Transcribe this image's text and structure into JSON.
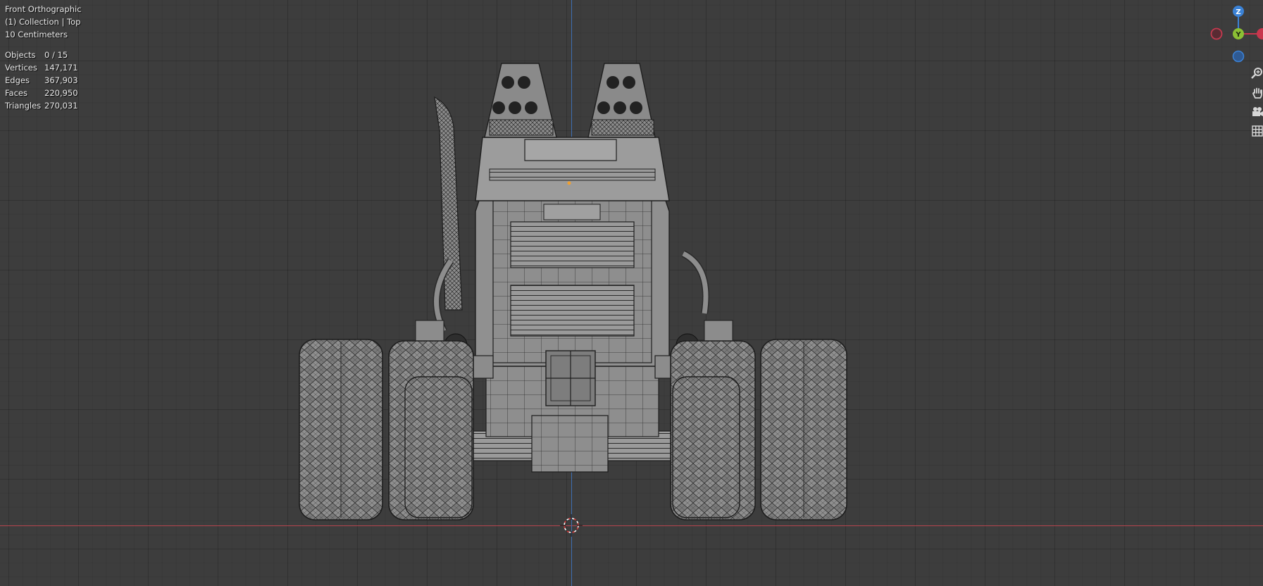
{
  "viewport": {
    "view_name": "Front Orthographic",
    "collection": "(1) Collection | Top",
    "grid_scale": "10 Centimeters"
  },
  "stats": [
    {
      "label": "Objects",
      "value": "0 / 15"
    },
    {
      "label": "Vertices",
      "value": "147,171"
    },
    {
      "label": "Edges",
      "value": "367,903"
    },
    {
      "label": "Faces",
      "value": "220,950"
    },
    {
      "label": "Triangles",
      "value": "270,031"
    }
  ],
  "gizmo": {
    "z_label": "Z",
    "y_label": "Y",
    "x_color": "#c8374d",
    "y_color": "#8bc034",
    "z_color": "#3b82d6"
  },
  "nav_tools": [
    {
      "name": "zoom-icon"
    },
    {
      "name": "hand-pan-icon"
    },
    {
      "name": "camera-icon"
    },
    {
      "name": "grid-icon"
    }
  ],
  "colors": {
    "background": "#3d3d3d",
    "x_axis_line": "#b5444d",
    "z_axis_line": "#3f6fb3",
    "model_fill": "#8a8a8a",
    "wire": "#1e1e1e"
  }
}
